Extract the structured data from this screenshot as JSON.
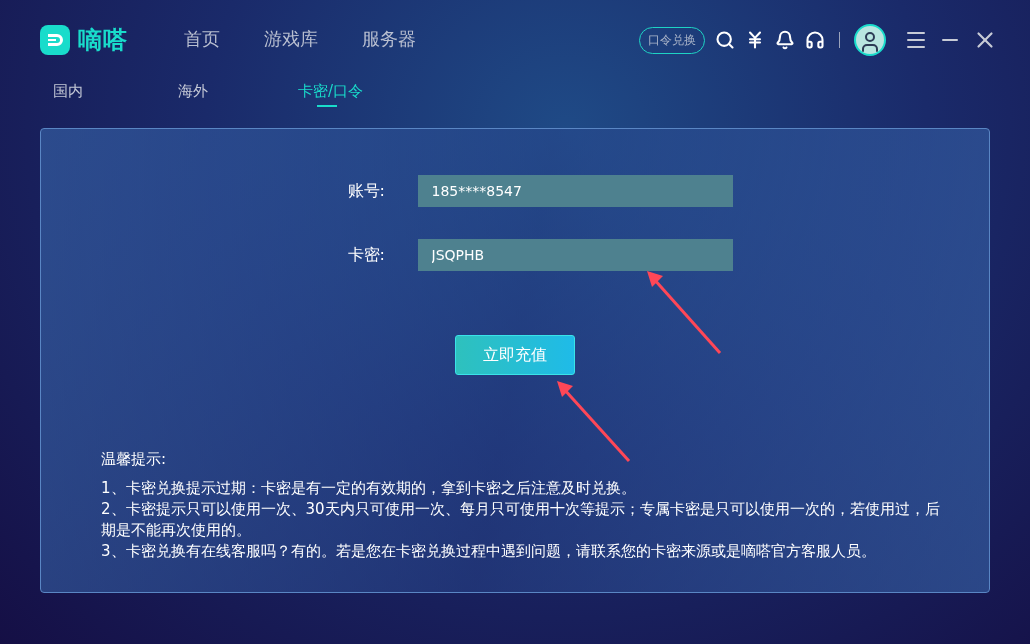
{
  "app": {
    "logo_text": "嘀嗒"
  },
  "nav": [
    {
      "label": "首页",
      "selected": false
    },
    {
      "label": "游戏库",
      "selected": false
    },
    {
      "label": "服务器",
      "selected": false
    }
  ],
  "toolbar": {
    "redeem_button": "口令兑换"
  },
  "tabs": [
    {
      "label": "国内",
      "selected": false
    },
    {
      "label": "海外",
      "selected": false
    },
    {
      "label": "卡密/口令",
      "selected": true
    }
  ],
  "form": {
    "fields": [
      {
        "label": "账号:",
        "value": "185****8547"
      },
      {
        "label": "卡密:",
        "value": "JSQPHB"
      }
    ],
    "submit": "立即充值"
  },
  "tips": {
    "title": "温馨提示:",
    "items": [
      "1、卡密兑换提示过期：卡密是有一定的有效期的，拿到卡密之后注意及时兑换。",
      "2、卡密提示只可以使用一次、30天内只可使用一次、每月只可使用十次等提示；专属卡密是只可以使用一次的，若使用过，后期是不能再次使用的。",
      "3、卡密兑换有在线客服吗？有的。若是您在卡密兑换过程中遇到问题，请联系您的卡密来源或是嘀嗒官方客服人员。"
    ]
  }
}
